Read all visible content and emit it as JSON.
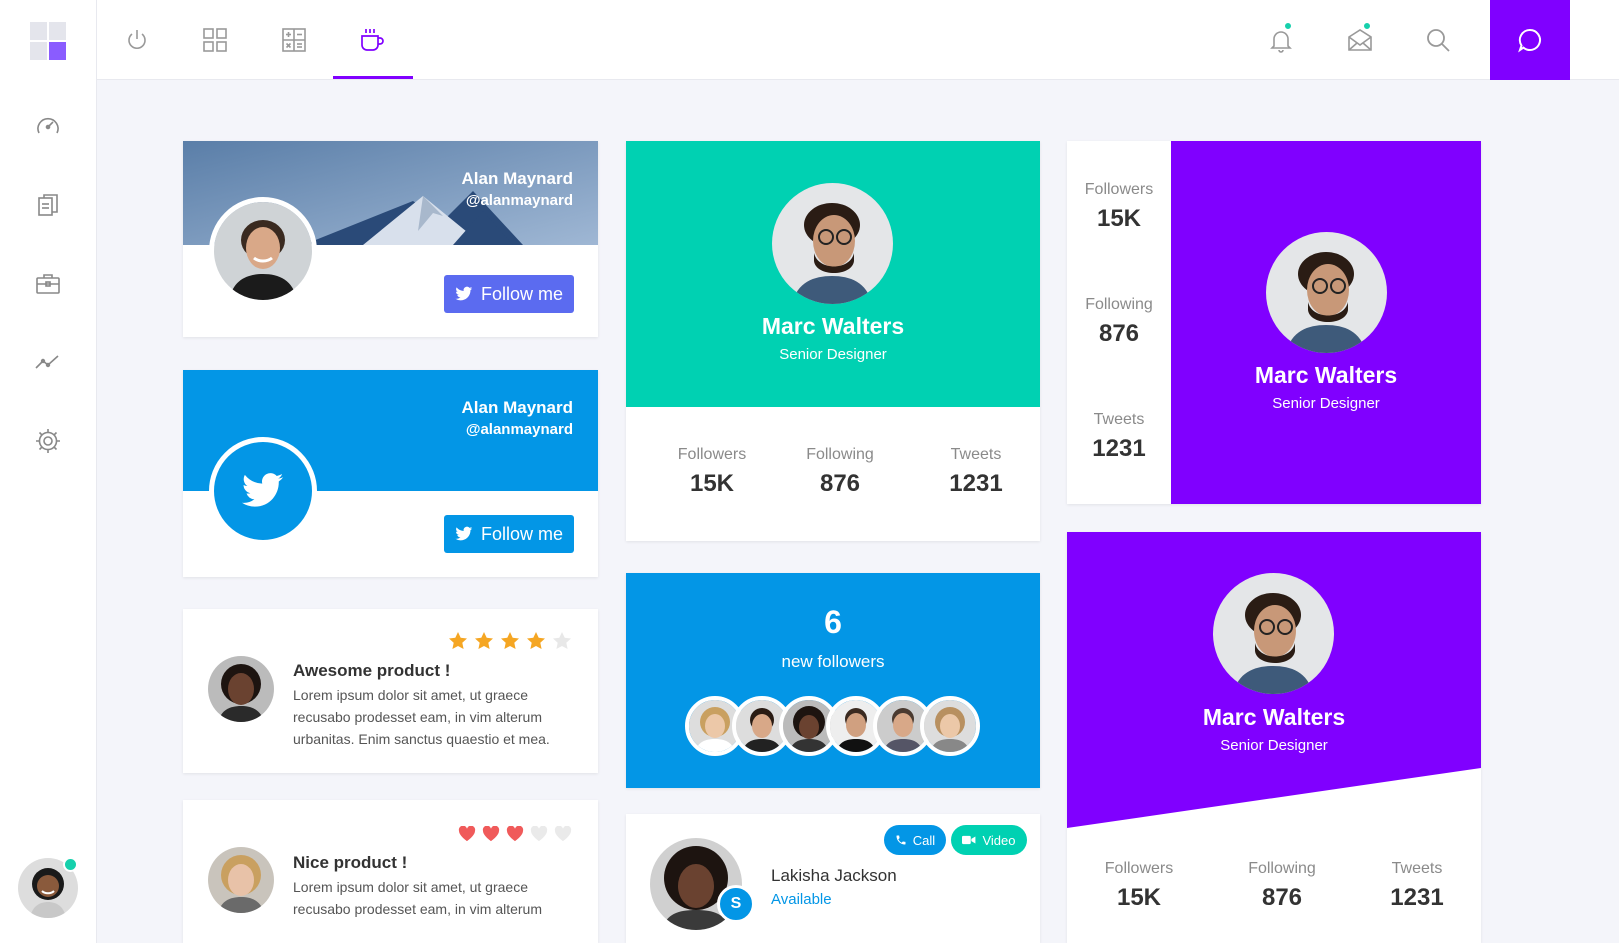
{
  "colors": {
    "purple": "#8000ff",
    "teal": "#00d1b2",
    "blue": "#0396e6",
    "indigo": "#5b6bf0",
    "status_green": "#16d0ac",
    "star": "#f5a623",
    "heart": "#f05a5a"
  },
  "sidebar": {
    "icons": [
      "speedometer-icon",
      "documents-icon",
      "briefcase-icon",
      "chart-line-icon",
      "gear-icon"
    ]
  },
  "topbar": {
    "icons": [
      "power-icon",
      "grid-icon",
      "calculator-icon",
      "coffee-icon",
      "bell-icon",
      "mail-icon",
      "search-icon",
      "chat-icon"
    ],
    "active_tab": "coffee-icon"
  },
  "card_alan_1": {
    "name": "Alan Maynard",
    "handle": "@alanmaynard",
    "button": "Follow me"
  },
  "card_alan_2": {
    "name": "Alan Maynard",
    "handle": "@alanmaynard",
    "button": "Follow me"
  },
  "review_1": {
    "title": "Awesome product !",
    "body": "Lorem ipsum dolor sit amet, ut graece recusabo prodesset eam, in vim alterum urbanitas. Enim sanctus quaestio et mea.",
    "rating": 4,
    "max": 5
  },
  "review_2": {
    "title": "Nice product !",
    "body": "Lorem ipsum dolor sit amet, ut graece recusabo prodesset eam, in vim alterum",
    "rating": 3,
    "max": 5
  },
  "marc_teal": {
    "name": "Marc Walters",
    "role": "Senior Designer",
    "stats": [
      {
        "label": "Followers",
        "value": "15K"
      },
      {
        "label": "Following",
        "value": "876"
      },
      {
        "label": "Tweets",
        "value": "1231"
      }
    ]
  },
  "new_followers": {
    "count": "6",
    "label": "new followers"
  },
  "contact": {
    "name": "Lakisha Jackson",
    "status": "Available",
    "call": "Call",
    "video": "Video"
  },
  "marc_side": {
    "name": "Marc Walters",
    "role": "Senior Designer",
    "stats": [
      {
        "label": "Followers",
        "value": "15K"
      },
      {
        "label": "Following",
        "value": "876"
      },
      {
        "label": "Tweets",
        "value": "1231"
      }
    ]
  },
  "marc_purple": {
    "name": "Marc Walters",
    "role": "Senior Designer",
    "stats": [
      {
        "label": "Followers",
        "value": "15K"
      },
      {
        "label": "Following",
        "value": "876"
      },
      {
        "label": "Tweets",
        "value": "1231"
      }
    ]
  }
}
